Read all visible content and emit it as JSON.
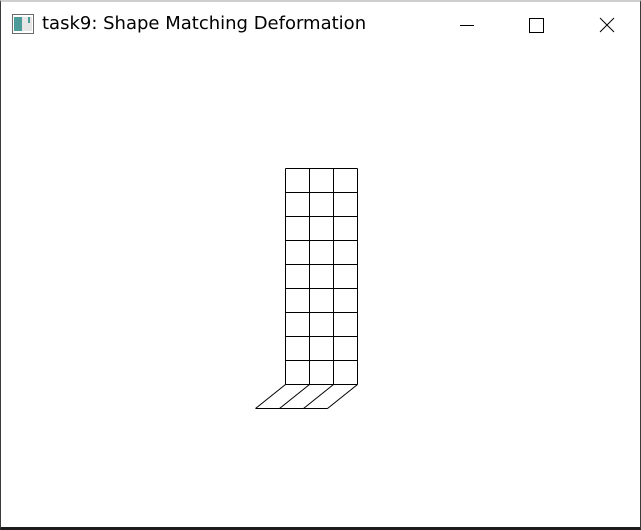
{
  "window": {
    "title": "task9: Shape Matching Deformation",
    "icon": "app-window-icon",
    "controls": {
      "minimize_icon": "minimize-icon",
      "maximize_icon": "maximize-icon",
      "close_icon": "close-icon"
    }
  },
  "canvas": {
    "background": "#ffffff",
    "line_color": "#000000",
    "mesh": {
      "columns": 3,
      "upright_rows": 9,
      "sheared_rows": 1
    }
  }
}
